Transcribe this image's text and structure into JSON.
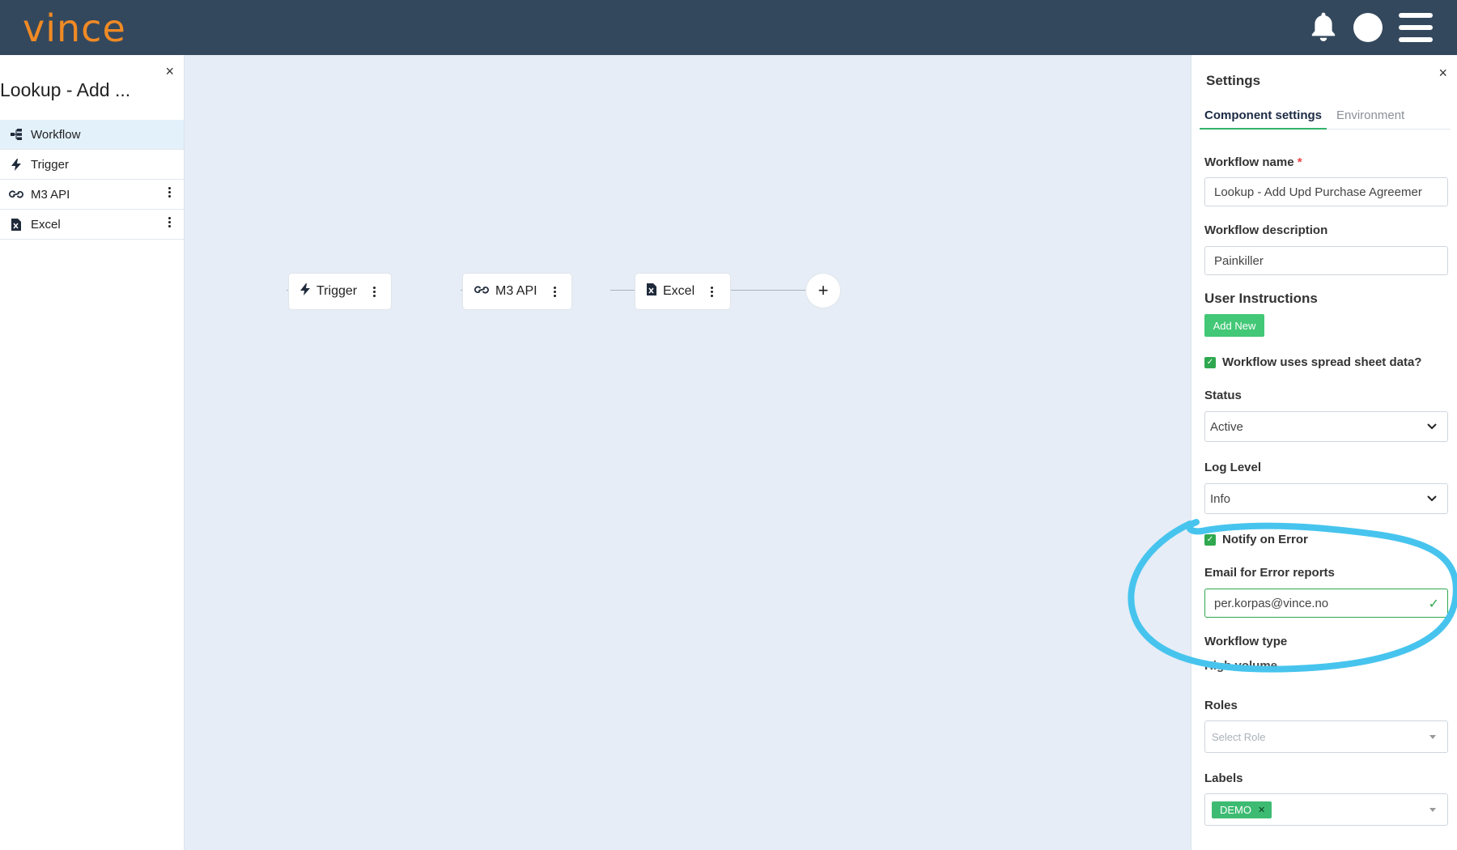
{
  "app": {
    "logo_text": "vince"
  },
  "topbar": {
    "icons": [
      "bell-icon",
      "avatar",
      "hamburger-menu-icon"
    ]
  },
  "left_panel": {
    "title": "Lookup - Add ...",
    "close": "×",
    "items": [
      {
        "label": "Workflow",
        "icon": "workflow-icon",
        "active": true
      },
      {
        "label": "Trigger",
        "icon": "bolt-icon"
      },
      {
        "label": "M3 API",
        "icon": "link-icon"
      },
      {
        "label": "Excel",
        "icon": "excel-file-icon"
      }
    ]
  },
  "canvas": {
    "nodes": [
      {
        "label": "Trigger",
        "icon": "bolt-icon"
      },
      {
        "label": "M3 API",
        "icon": "link-icon"
      },
      {
        "label": "Excel",
        "icon": "excel-file-icon"
      }
    ],
    "add_label": "+"
  },
  "settings": {
    "title": "Settings",
    "close": "×",
    "tabs": [
      "Component settings",
      "Environment"
    ],
    "workflow_name_label": "Workflow name",
    "required_mark": "*",
    "workflow_name_value": "Lookup - Add Upd Purchase Agreemer",
    "workflow_description_label": "Workflow description",
    "workflow_description_value": "Painkiller",
    "user_instructions_label": "User Instructions",
    "add_new_label": "Add New",
    "spreadsheet_label": "Workflow uses spread sheet data?",
    "status_label": "Status",
    "status_value": "Active",
    "log_level_label": "Log Level",
    "log_level_value": "Info",
    "notify_label": "Notify on Error",
    "email_label": "Email for Error reports",
    "email_value": "per.korpas@vince.no",
    "workflow_type_label": "Workflow type",
    "workflow_type_value": "High volume",
    "roles_label": "Roles",
    "roles_placeholder": "Select Role",
    "labels_label": "Labels",
    "labels_tags": [
      "DEMO"
    ]
  },
  "colors": {
    "topbar": "#34485d",
    "logo": "#f08a24",
    "canvas": "#e6edf6",
    "accent_green": "#42c876",
    "annotation": "#47c4ee"
  }
}
